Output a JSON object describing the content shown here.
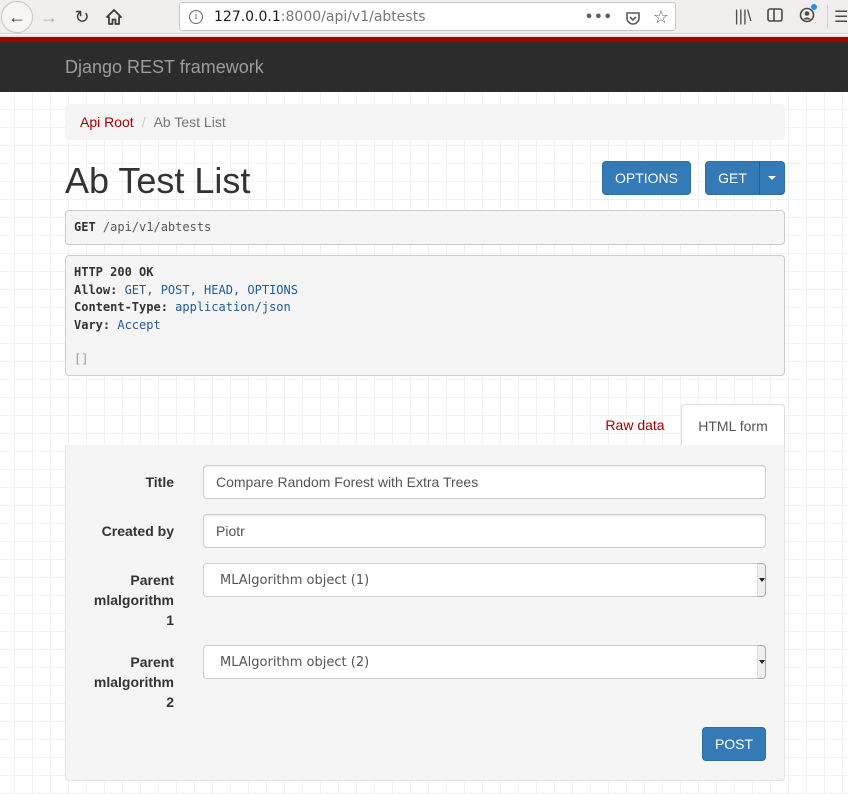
{
  "browser": {
    "url_host": "127.0.0.1",
    "url_rest": ":8000/api/v1/abtests",
    "icons": [
      "back-icon",
      "forward-icon",
      "reload-icon",
      "home-icon",
      "info-icon",
      "more-icon",
      "pocket-icon",
      "bookmark-star-icon",
      "library-icon",
      "sidebar-icon",
      "account-icon",
      "menu-icon"
    ]
  },
  "navbar": {
    "brand": "Django REST framework"
  },
  "breadcrumb": {
    "items": [
      {
        "label": "Api Root",
        "link": true
      },
      {
        "label": "Ab Test List",
        "link": false
      }
    ],
    "separator": "/"
  },
  "page": {
    "title": "Ab Test List",
    "options_label": "OPTIONS",
    "get_label": "GET"
  },
  "request": {
    "method": "GET",
    "path": " /api/v1/abtests"
  },
  "response": {
    "status": "HTTP 200 OK",
    "headers": [
      {
        "key": "Allow:",
        "value": " GET, POST, HEAD, OPTIONS"
      },
      {
        "key": "Content-Type:",
        "value": " application/json"
      },
      {
        "key": "Vary:",
        "value": " Accept"
      }
    ],
    "body": "[]"
  },
  "tabs": {
    "raw": "Raw data",
    "html": "HTML form",
    "active": "html"
  },
  "form": {
    "fields": [
      {
        "label": "Title",
        "value": "Compare Random Forest with Extra Trees",
        "type": "text"
      },
      {
        "label": "Created by",
        "value": "Piotr",
        "type": "text"
      },
      {
        "label_lines": [
          "Parent",
          "mlalgorithm",
          "1"
        ],
        "value": "MLAlgorithm object (1)",
        "type": "select"
      },
      {
        "label_lines": [
          "Parent",
          "mlalgorithm",
          "2"
        ],
        "value": "MLAlgorithm object (2)",
        "type": "select"
      }
    ],
    "submit_label": "POST"
  },
  "colors": {
    "brand_red": "#a30000",
    "primary_blue": "#337ab7",
    "navbar_bg": "#2c2c2c"
  }
}
